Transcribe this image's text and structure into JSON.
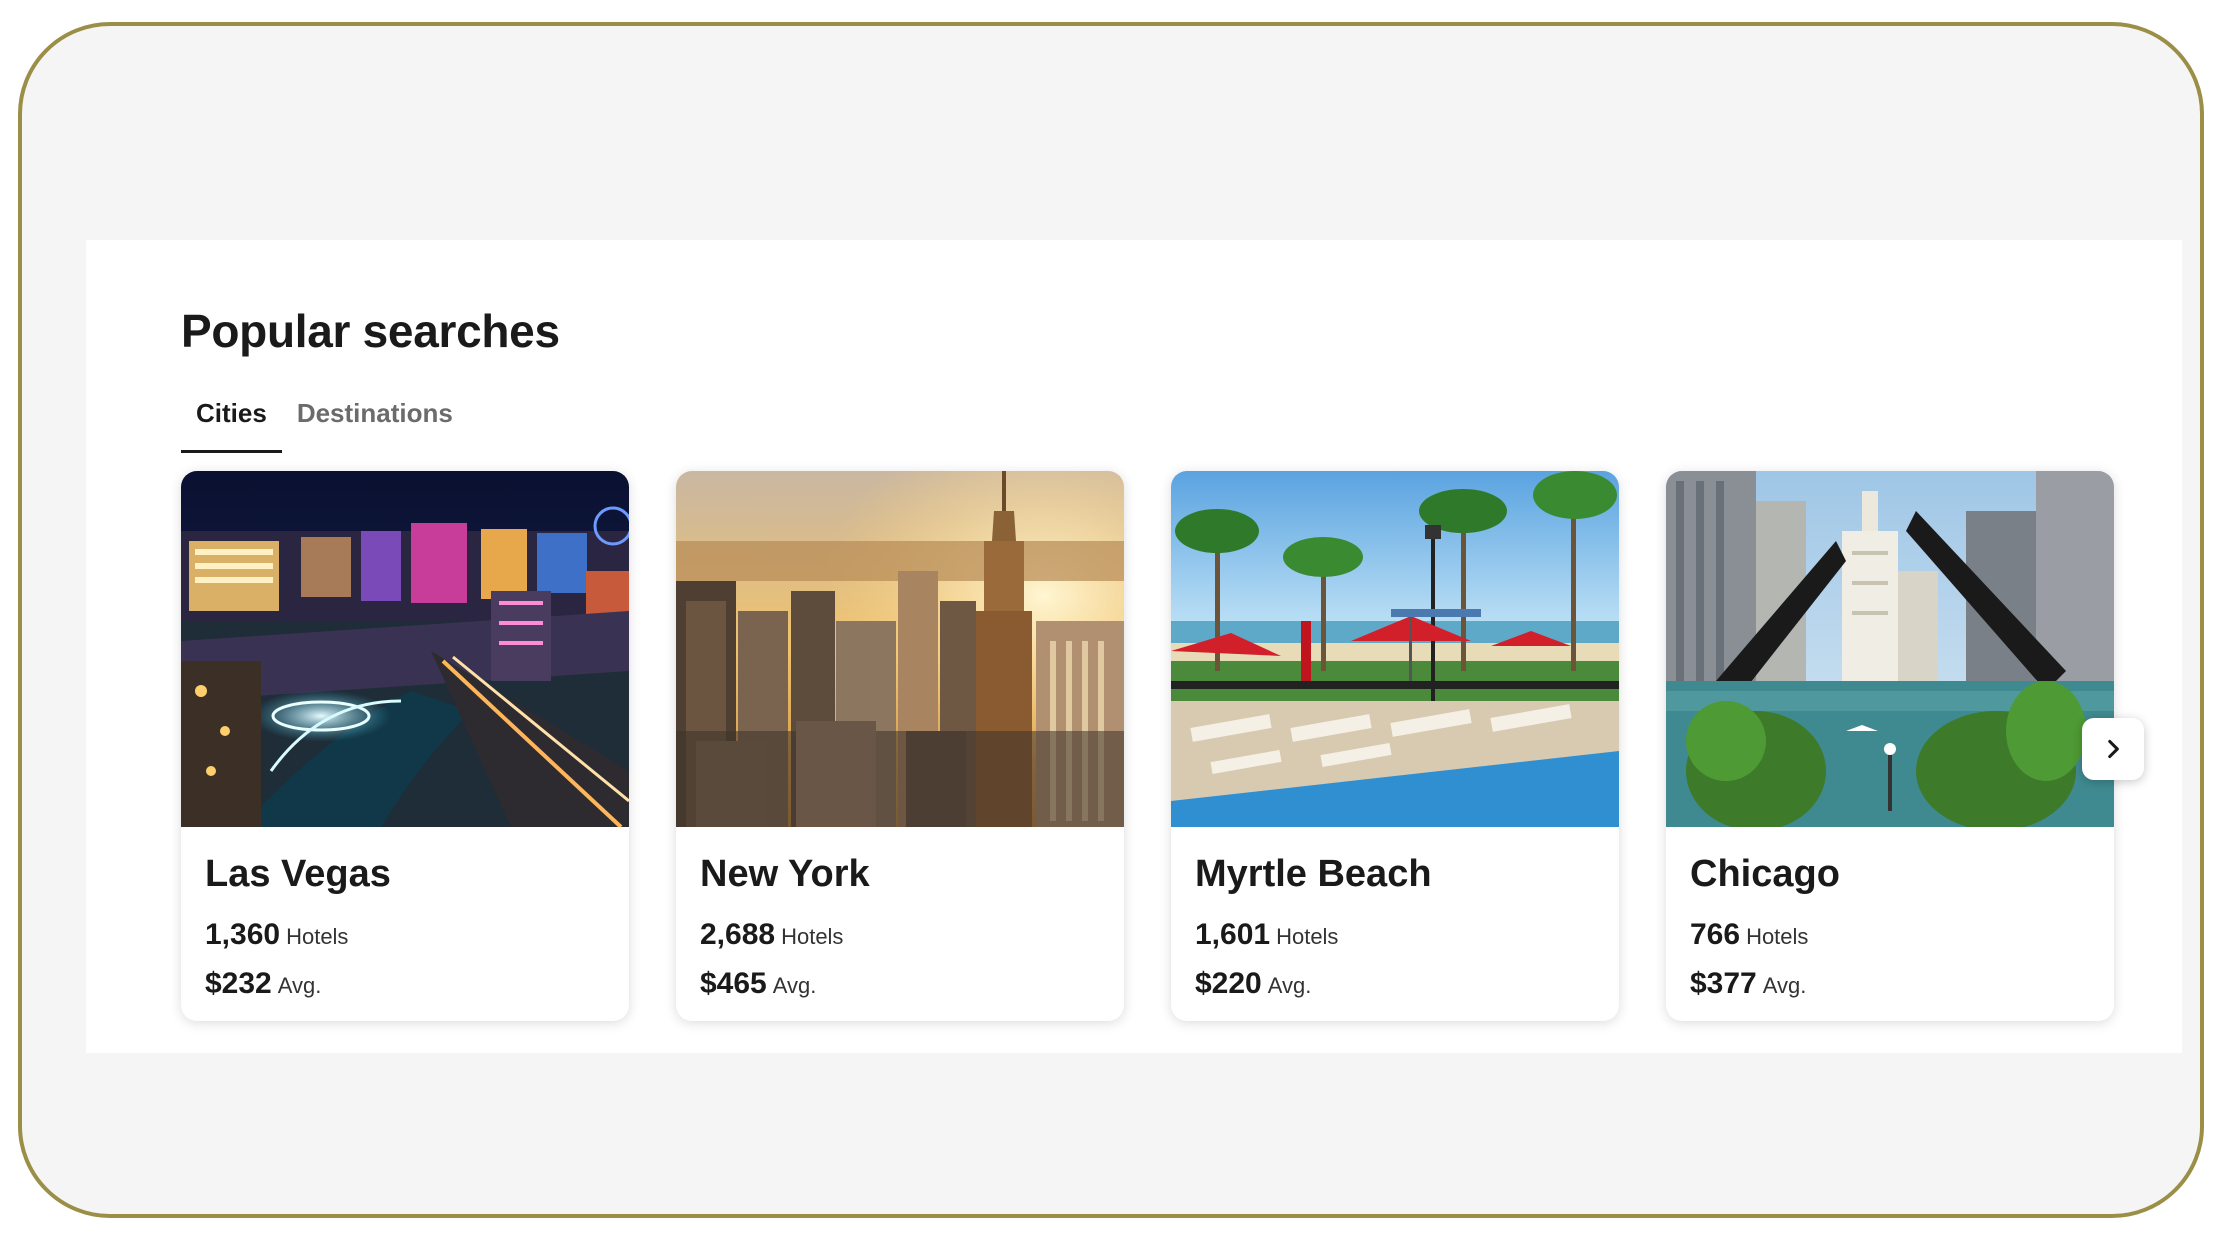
{
  "section": {
    "title": "Popular searches"
  },
  "tabs": [
    {
      "label": "Cities",
      "active": true
    },
    {
      "label": "Destinations",
      "active": false
    }
  ],
  "cards": [
    {
      "city": "Las Vegas",
      "hotels": "1,360",
      "hotels_label": "Hotels",
      "avg_price": "$232",
      "avg_label": "Avg."
    },
    {
      "city": "New York",
      "hotels": "2,688",
      "hotels_label": "Hotels",
      "avg_price": "$465",
      "avg_label": "Avg."
    },
    {
      "city": "Myrtle Beach",
      "hotels": "1,601",
      "hotels_label": "Hotels",
      "avg_price": "$220",
      "avg_label": "Avg."
    },
    {
      "city": "Chicago",
      "hotels": "766",
      "hotels_label": "Hotels",
      "avg_price": "$377",
      "avg_label": "Avg."
    }
  ],
  "carousel": {
    "next_icon": "chevron-right-icon"
  },
  "colors": {
    "frame_border": "#9b8f47",
    "frame_background": "#f5f5f5",
    "panel_background": "#ffffff",
    "text_primary": "#1a1a1a",
    "tab_inactive": "#6b6b6b"
  }
}
